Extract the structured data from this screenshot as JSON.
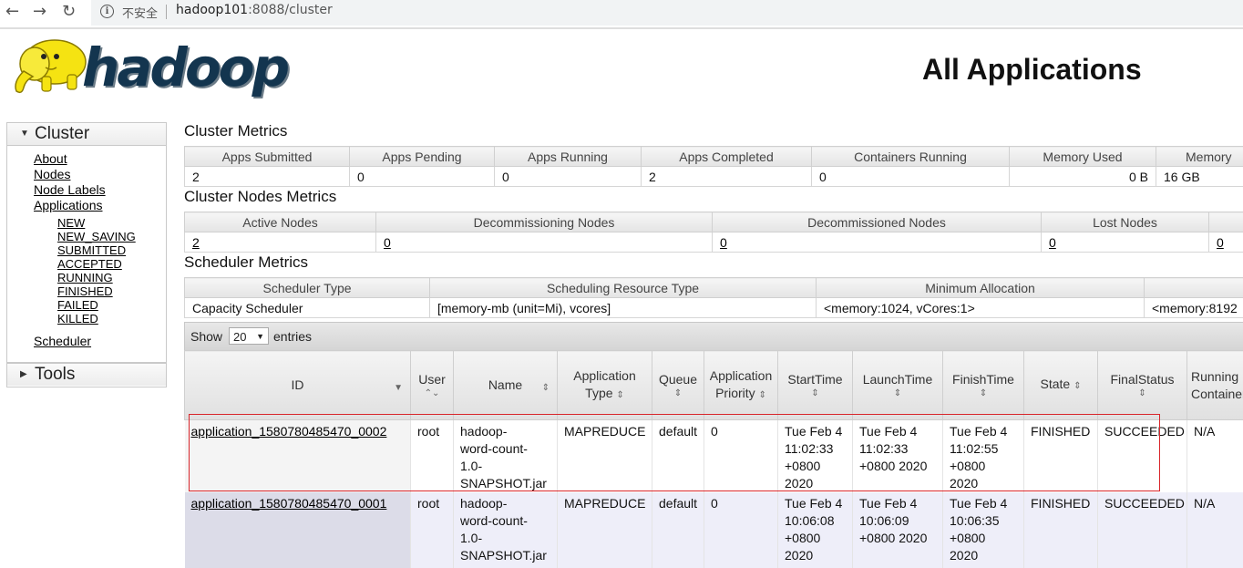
{
  "browser": {
    "security_label": "不安全",
    "url_host": "hadoop101",
    "url_rest": ":8088/cluster"
  },
  "header": {
    "logo_text": "hadoop",
    "title": "All Applications"
  },
  "sidebar": {
    "cluster_label": "Cluster",
    "links": [
      "About",
      "Nodes",
      "Node Labels",
      "Applications"
    ],
    "app_states": [
      "NEW",
      "NEW_SAVING",
      "SUBMITTED",
      "ACCEPTED",
      "RUNNING",
      "FINISHED",
      "FAILED",
      "KILLED"
    ],
    "scheduler_label": "Scheduler",
    "tools_label": "Tools"
  },
  "cluster_metrics": {
    "title": "Cluster Metrics",
    "headers": [
      "Apps Submitted",
      "Apps Pending",
      "Apps Running",
      "Apps Completed",
      "Containers Running",
      "Memory Used",
      "Memory"
    ],
    "values": [
      "2",
      "0",
      "0",
      "2",
      "0",
      "0 B",
      "16 GB"
    ]
  },
  "node_metrics": {
    "title": "Cluster Nodes Metrics",
    "headers": [
      "Active Nodes",
      "Decommissioning Nodes",
      "Decommissioned Nodes",
      "Lost Nodes",
      ""
    ],
    "values": [
      "2",
      "0",
      "0",
      "0",
      "0"
    ]
  },
  "scheduler_metrics": {
    "title": "Scheduler Metrics",
    "headers": [
      "Scheduler Type",
      "Scheduling Resource Type",
      "Minimum Allocation",
      ""
    ],
    "values": [
      "Capacity Scheduler",
      "[memory-mb (unit=Mi), vcores]",
      "<memory:1024, vCores:1>",
      "<memory:8192"
    ]
  },
  "apps_table": {
    "show_label": "Show",
    "page_size": "20",
    "entries_label": "entries",
    "columns": {
      "id": "ID",
      "user": "User",
      "name": "Name",
      "app_type_1": "Application",
      "app_type_2": "Type",
      "queue": "Queue",
      "priority_1": "Application",
      "priority_2": "Priority",
      "start": "StartTime",
      "launch": "LaunchTime",
      "finish": "FinishTime",
      "state": "State",
      "final": "FinalStatus",
      "running_1": "Running",
      "running_2": "Containers"
    },
    "rows": [
      {
        "id": "application_1580780485470_0002",
        "user": "root",
        "name": [
          "hadoop-",
          "word-count-",
          "1.0-",
          "SNAPSHOT.jar"
        ],
        "type": "MAPREDUCE",
        "queue": "default",
        "priority": "0",
        "start": [
          "Tue Feb 4",
          "11:02:33",
          "+0800",
          "2020"
        ],
        "launch": [
          "Tue Feb 4",
          "11:02:33",
          "+0800 2020"
        ],
        "finish": [
          "Tue Feb 4",
          "11:02:55",
          "+0800",
          "2020"
        ],
        "state": "FINISHED",
        "final": "SUCCEEDED",
        "running": "N/A"
      },
      {
        "id": "application_1580780485470_0001",
        "user": "root",
        "name": [
          "hadoop-",
          "word-count-",
          "1.0-",
          "SNAPSHOT.jar"
        ],
        "type": "MAPREDUCE",
        "queue": "default",
        "priority": "0",
        "start": [
          "Tue Feb 4",
          "10:06:08",
          "+0800",
          "2020"
        ],
        "launch": [
          "Tue Feb 4",
          "10:06:09",
          "+0800 2020"
        ],
        "finish": [
          "Tue Feb 4",
          "10:06:35",
          "+0800",
          "2020"
        ],
        "state": "FINISHED",
        "final": "SUCCEEDED",
        "running": "N/A"
      }
    ]
  },
  "colors": {
    "highlight_border": "#d9262b",
    "logo_text": "#13354f",
    "logo_elephant": "#f5e312"
  }
}
